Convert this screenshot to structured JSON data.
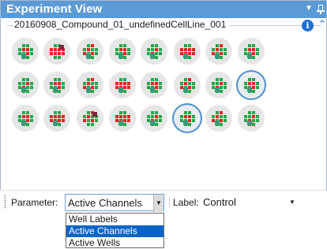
{
  "window": {
    "title": "Experiment View"
  },
  "group": {
    "label": "20160908_Compound_01_undefinedCellLine_001"
  },
  "wells": [
    [
      {
        "pattern": "a",
        "marker": "t",
        "selected": false
      },
      {
        "pattern": "b",
        "marker": "p",
        "selected": false
      },
      {
        "pattern": "c",
        "marker": "t",
        "selected": false
      },
      {
        "pattern": "a",
        "marker": "t",
        "selected": false
      },
      {
        "pattern": "d",
        "marker": "t",
        "selected": false
      },
      {
        "pattern": "b",
        "marker": "t",
        "selected": false
      },
      {
        "pattern": "c",
        "marker": "t",
        "selected": false
      },
      {
        "pattern": "a",
        "marker": "t",
        "selected": false
      }
    ],
    [
      {
        "pattern": "d",
        "marker": "t",
        "selected": false
      },
      {
        "pattern": "a",
        "marker": "t",
        "selected": false
      },
      {
        "pattern": "c",
        "marker": "t",
        "selected": false
      },
      {
        "pattern": "b",
        "marker": "t",
        "selected": false
      },
      {
        "pattern": "a",
        "marker": "t",
        "selected": false
      },
      {
        "pattern": "c",
        "marker": "t",
        "selected": false
      },
      {
        "pattern": "d",
        "marker": "t",
        "selected": false
      },
      {
        "pattern": "a",
        "marker": "t",
        "selected": true
      }
    ],
    [
      {
        "pattern": "a",
        "marker": "t",
        "selected": false
      },
      {
        "pattern": "b",
        "marker": "t",
        "selected": false
      },
      {
        "pattern": "c",
        "marker": "p",
        "selected": false
      },
      {
        "pattern": "b",
        "marker": "t",
        "selected": false
      },
      {
        "pattern": "d",
        "marker": "t",
        "selected": false
      },
      {
        "pattern": "a",
        "marker": "t",
        "selected": true
      },
      {
        "pattern": "c",
        "marker": "t",
        "selected": false
      },
      {
        "pattern": "d",
        "marker": "t",
        "selected": false
      }
    ]
  ],
  "toolbar": {
    "parameter_label": "Parameter:",
    "parameter_value": "Active Channels",
    "label_label": "Label:",
    "label_value": "Control"
  },
  "dropdown": {
    "options": [
      {
        "label": "Well Labels",
        "selected": false
      },
      {
        "label": "Active Channels",
        "selected": true
      },
      {
        "label": "Active Wells",
        "selected": false
      }
    ]
  },
  "colors": {
    "title_bar": "#5b9bd5",
    "channel_active": "#1fa84a",
    "channel_inactive": "#e32424",
    "selection": "#0a64c8"
  }
}
